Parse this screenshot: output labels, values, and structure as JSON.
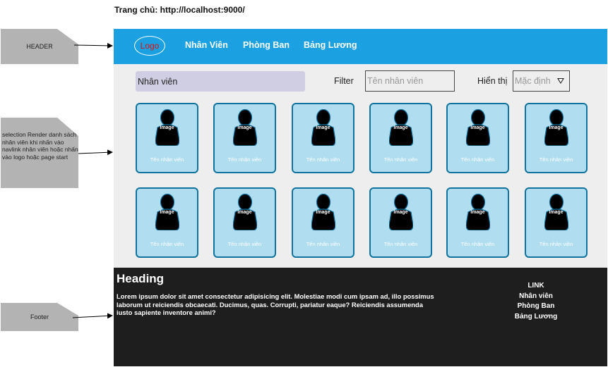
{
  "page_title": "Trang chủ: http://localhost:9000/",
  "notes": {
    "header": "HEADER",
    "section": "selection Render danh sách nhân viên khi nhấn vào navlink nhân viên hoặc nhấn vào logo hoặc page start",
    "footer": "Footer"
  },
  "header": {
    "logo": "Logo",
    "nav": [
      "Nhân Viên",
      "Phòng Ban",
      "Bảng Lương"
    ]
  },
  "toolbar": {
    "search_value": "Nhân viên",
    "filter_label": "Filter",
    "filter_placeholder": "Tên nhân viên",
    "display_label": "Hiển thị",
    "display_value": "Mặc định"
  },
  "cards": [
    {
      "image": "Image",
      "name": "Tên nhân viên"
    },
    {
      "image": "Image",
      "name": "Tên nhân viên"
    },
    {
      "image": "Image",
      "name": "Tên nhân viên"
    },
    {
      "image": "Image",
      "name": "Tên nhân viên"
    },
    {
      "image": "Image",
      "name": "Tên nhân viên"
    },
    {
      "image": "Image",
      "name": "Tên nhân viên"
    },
    {
      "image": "Image",
      "name": "Tên nhân viên"
    },
    {
      "image": "Image",
      "name": "Tên nhân viên"
    },
    {
      "image": "Image",
      "name": "Tên nhân viên"
    },
    {
      "image": "Image",
      "name": "Tên nhân viên"
    },
    {
      "image": "Image",
      "name": "Tên nhân viên"
    },
    {
      "image": "Image",
      "name": "Tên nhân viên"
    }
  ],
  "footer": {
    "heading": "Heading",
    "text": "Lorem ipsum dolor sit amet consectetur adipisicing elit. Molestiae modi cum ipsam ad, illo possimus laborum ut reiciendis obcaecati. Ducimus, quas. Corrupti, pariatur eaque? Reiciendis assumenda iusto sapiente inventore animi?",
    "links_title": "LINK",
    "links": [
      "Nhân viên",
      "Phòng Ban",
      "Bảng Lương"
    ]
  },
  "colors": {
    "header_bg": "#1ba1e2",
    "card_fill": "#b1ddf0",
    "card_border": "#10739e",
    "footer_bg": "#1e1e1e",
    "logo_text": "#e01010"
  }
}
